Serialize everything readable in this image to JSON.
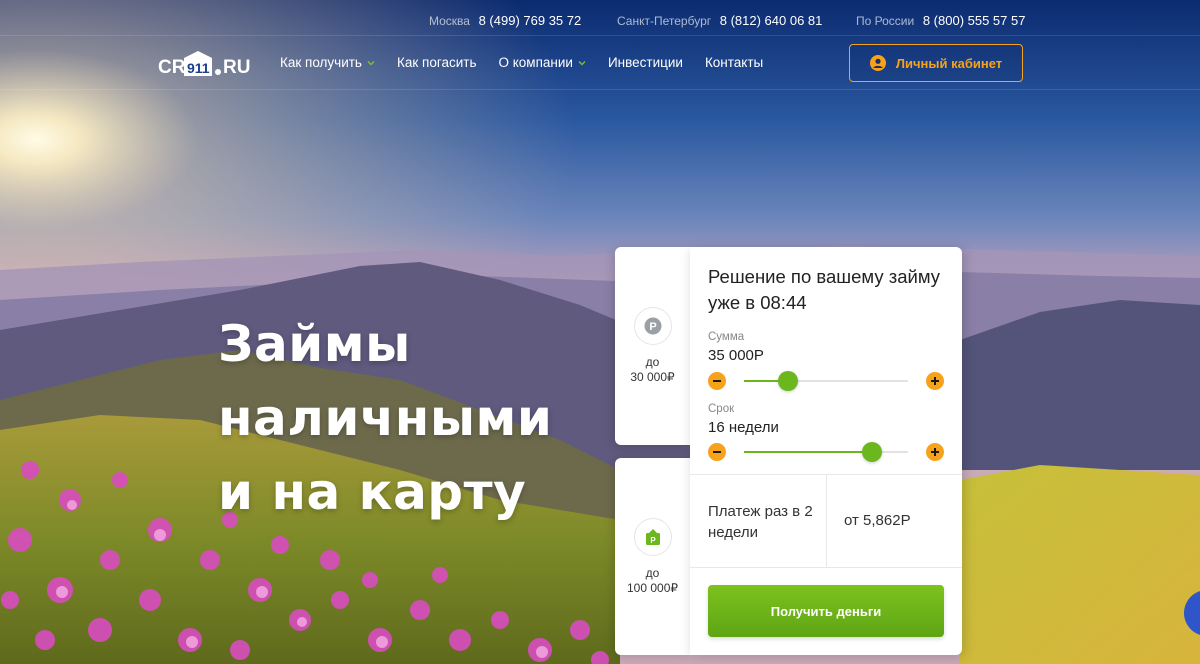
{
  "header": {
    "phones": [
      {
        "city": "Москва",
        "number": "8 (499) 769 35 72"
      },
      {
        "city": "Санкт-Петербург",
        "number": "8 (812) 640 06 81"
      },
      {
        "city": "По России",
        "number": "8 (800) 555 57 57"
      }
    ],
    "logo_text": "CR911.RU",
    "nav": [
      {
        "label": "Как получить",
        "dropdown": true
      },
      {
        "label": "Как погасить",
        "dropdown": false
      },
      {
        "label": "О компании",
        "dropdown": true
      },
      {
        "label": "Инвестиции",
        "dropdown": false
      },
      {
        "label": "Контакты",
        "dropdown": false
      }
    ],
    "cabinet_label": "Личный кабинет"
  },
  "hero": {
    "title_lines": [
      "Займы",
      "наличными",
      "и на карту"
    ]
  },
  "side_cards": [
    {
      "label_line1": "до",
      "label_line2": "30 000₽",
      "icon": "ruble-coin-icon"
    },
    {
      "label_line1": "до",
      "label_line2": "100 000₽",
      "icon": "card-wallet-icon"
    }
  ],
  "calculator": {
    "title": "Решение по вашему займу уже в 08:44",
    "amount_label": "Сумма",
    "amount_value": "35 000Р",
    "amount_fraction": 0.27,
    "term_label": "Срок",
    "term_value": "16 недели",
    "term_fraction": 0.78,
    "payment_label": "Платеж раз в 2 недели",
    "payment_value": "от 5,862Р",
    "submit_label": "Получить деньги"
  },
  "colors": {
    "accent_orange": "#f7a21b",
    "accent_green": "#6cb71d"
  }
}
